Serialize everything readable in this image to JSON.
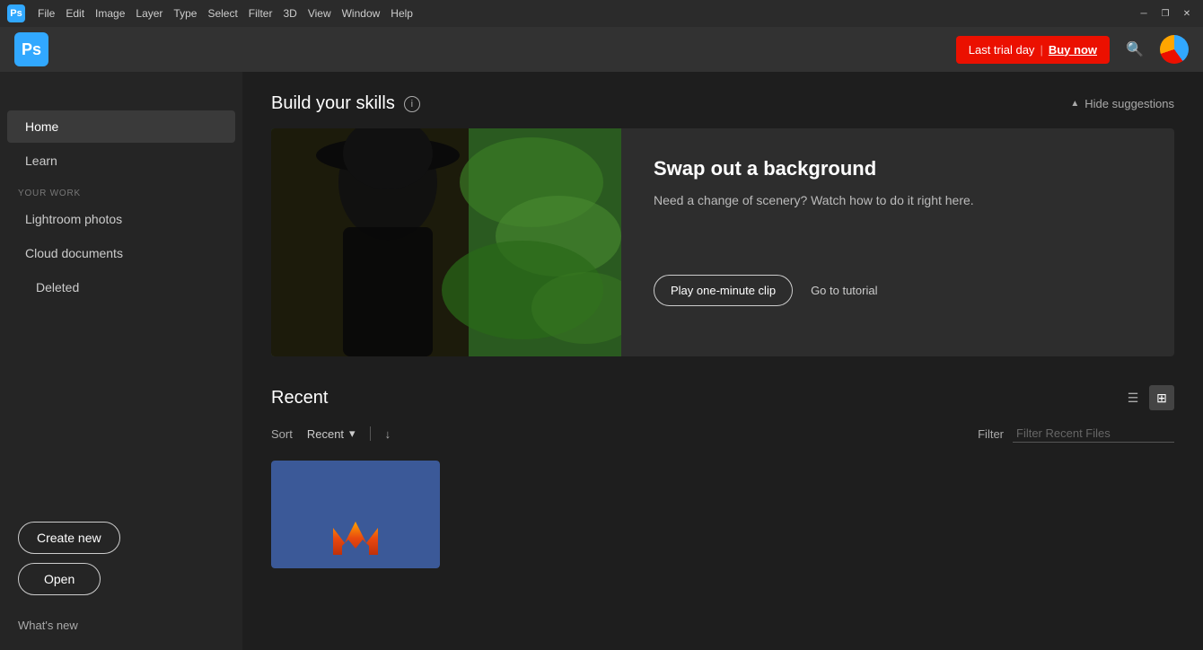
{
  "titlebar": {
    "menus": [
      "File",
      "Edit",
      "Image",
      "Layer",
      "Type",
      "Select",
      "Filter",
      "3D",
      "View",
      "Window",
      "Help"
    ],
    "ps_label": "Ps",
    "win_min": "─",
    "win_restore": "❐",
    "win_close": "✕"
  },
  "appbar": {
    "ps_label": "Ps",
    "trial_label": "Last trial day",
    "buy_label": "Buy now",
    "search_icon": "🔍"
  },
  "sidebar": {
    "nav_items": [
      {
        "label": "Home",
        "active": true
      },
      {
        "label": "Learn",
        "active": false
      }
    ],
    "section_label": "YOUR WORK",
    "work_items": [
      {
        "label": "Lightroom photos"
      },
      {
        "label": "Cloud documents"
      },
      {
        "label": "Deleted"
      }
    ],
    "create_label": "Create new",
    "open_label": "Open",
    "whats_new_label": "What's new"
  },
  "skills": {
    "title": "Build your skills",
    "hide_label": "Hide suggestions",
    "card": {
      "title": "Swap out a background",
      "description": "Need a change of scenery? Watch how to do it right here.",
      "play_label": "Play one-minute clip",
      "tutorial_label": "Go to tutorial"
    }
  },
  "recent": {
    "title": "Recent",
    "sort_label": "Sort",
    "sort_value": "Recent",
    "filter_label": "Filter",
    "filter_placeholder": "Filter Recent Files",
    "view_list_icon": "≡",
    "view_grid_icon": "⊞"
  },
  "colors": {
    "accent_blue": "#31a8ff",
    "accent_red": "#eb1000",
    "bg_dark": "#1e1e1e",
    "bg_sidebar": "#252525",
    "bg_appbar": "#323232"
  }
}
